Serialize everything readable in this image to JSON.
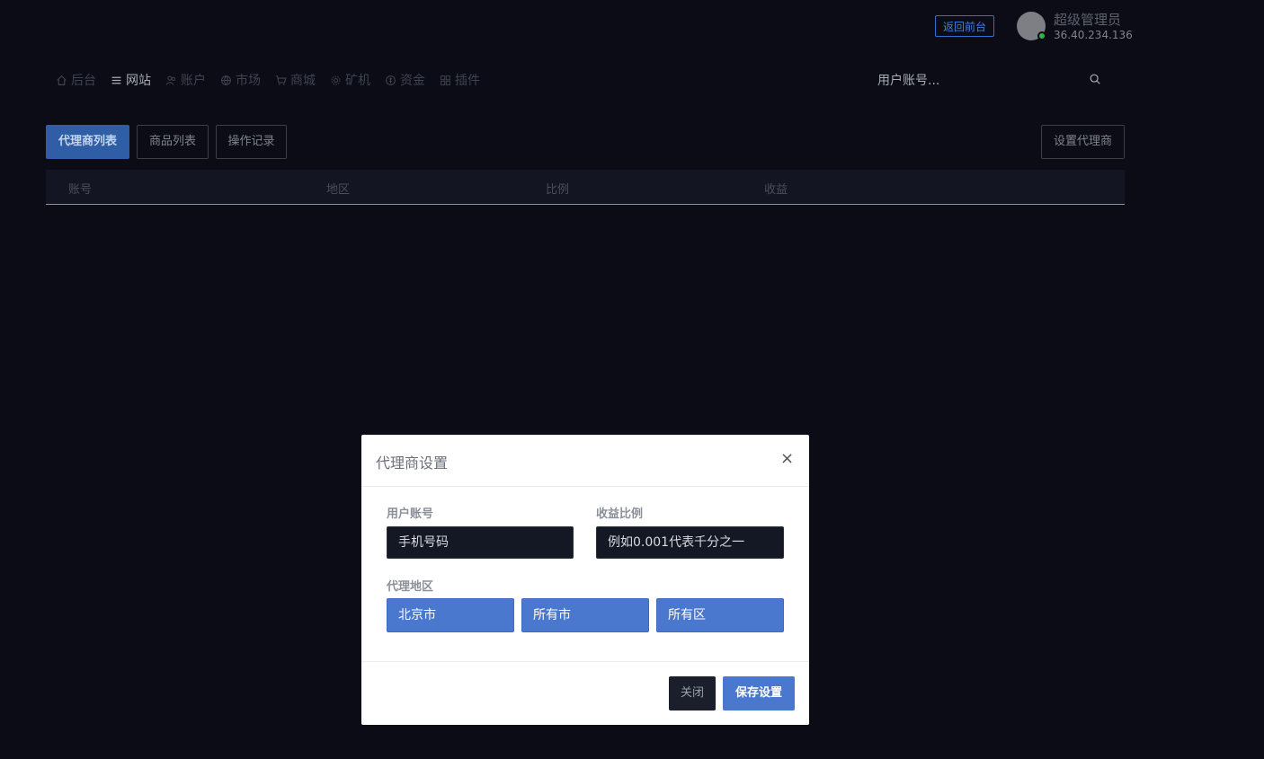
{
  "header": {
    "back_button": "返回前台",
    "admin_name": "超级管理员",
    "admin_ip": "36.40.234.136"
  },
  "nav": {
    "items": [
      {
        "label": "后台",
        "icon": "home-icon",
        "active": false
      },
      {
        "label": "网站",
        "icon": "list-icon",
        "active": true
      },
      {
        "label": "账户",
        "icon": "users-icon",
        "active": false
      },
      {
        "label": "市场",
        "icon": "globe-icon",
        "active": false
      },
      {
        "label": "商城",
        "icon": "cart-icon",
        "active": false
      },
      {
        "label": "矿机",
        "icon": "gear-icon",
        "active": false
      },
      {
        "label": "资金",
        "icon": "currency-icon",
        "active": false
      },
      {
        "label": "插件",
        "icon": "grid-icon",
        "active": false
      }
    ],
    "search_placeholder": "用户账号..."
  },
  "tabs": {
    "agent_list": "代理商列表",
    "product_list": "商品列表",
    "operation_log": "操作记录",
    "set_agent": "设置代理商"
  },
  "table": {
    "columns": [
      "账号",
      "地区",
      "比例",
      "收益"
    ]
  },
  "modal": {
    "title": "代理商设置",
    "close_symbol": "×",
    "account_label": "用户账号",
    "account_placeholder": "手机号码",
    "ratio_label": "收益比例",
    "ratio_placeholder": "例如0.001代表千分之一",
    "region_label": "代理地区",
    "province": "北京市",
    "city": "所有市",
    "district": "所有区",
    "close_button": "关闭",
    "save_button": "保存设置"
  },
  "colors": {
    "background": "#0b0c15",
    "accent": "#4a78cf",
    "active_tab": "#2f5ea7",
    "online": "#36b04a"
  }
}
